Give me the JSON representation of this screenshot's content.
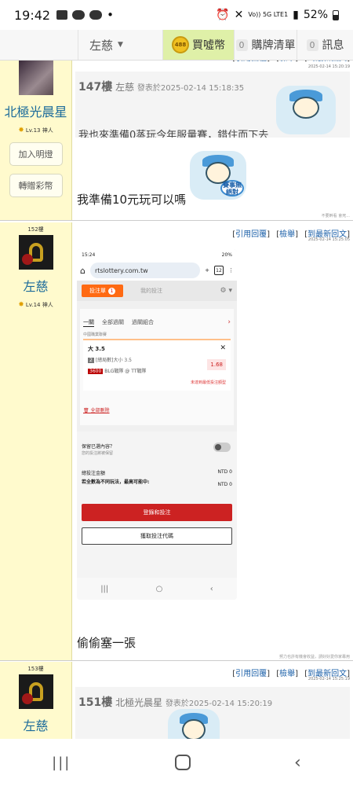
{
  "status": {
    "time": "19:42",
    "network": "Vo)) 5G LTE1",
    "battery": "52%"
  },
  "topnav": {
    "user": "左慈",
    "coins_icon_text": "488",
    "coins": "買噓幣",
    "cart_count": "0",
    "cart": "購牌清單",
    "msg_count": "0",
    "msg": "訊息"
  },
  "actions": {
    "quote": "引用回覆",
    "report": "檢舉",
    "latest": "到最新回文"
  },
  "post_prev": {
    "username": "北極光晨星",
    "level": "Lv.13 神人",
    "btn_light": "加入明燈",
    "btn_gift": "轉贈彩幣",
    "timestamp": "2025-02-14 15:20:19",
    "quote_floor": "147樓",
    "quote_user": "左慈",
    "quote_time": "發表於2025-02-14 15:18:35",
    "quote_text": "我也來準備0蒸玩今年服量賽，錯住而下去",
    "body": "我準備10元玩可以嗎",
    "sticker_sign": "賽事無絕對",
    "footnote": "不要幹看 會死..."
  },
  "post_main": {
    "floor": "152樓",
    "username": "左慈",
    "level": "Lv.14 神人",
    "timestamp": "2025-02-14 15:25:05",
    "body": "偷偷塞一張",
    "footnote": "努力也許有機會收益，請好好愛你家專用"
  },
  "screenshot": {
    "status_time": "15:24",
    "status_right": "20%",
    "url": "rtslottery.com.tw",
    "tabs_count": "12",
    "tab_active": "投注單",
    "tab_active_num": "1",
    "tab_inactive": "我的投注",
    "ptab1": "一關",
    "ptab2": "全部過關",
    "ptab3": "過關組合",
    "league": "中國職業聯賽",
    "bet_title": "大 3.5",
    "bet_detail_num": "2",
    "bet_detail": "[總局數]大小 3.5",
    "bet_code": "3600",
    "bet_match": "BLG戰隊 @ TT戰隊",
    "odds": "1.68",
    "warn": "未達到最低投注額型",
    "delete_all": "全部刪除",
    "keep_q": "保留已選內容？",
    "keep_hint": "您的投注將被保留",
    "total_label": "總投注金額",
    "total_value": "NTD 0",
    "max_label": "若全數為不同玩法，最高可能中:",
    "max_value": "NTD 0",
    "btn_login": "登錄和投注",
    "btn_code": "獲取投注代碼"
  },
  "post_next": {
    "floor": "153樓",
    "username": "左慈",
    "timestamp": "2025-02-14 15:25:19",
    "quote_floor": "151樓",
    "quote_user": "北極光晨星",
    "quote_time": "發表於2025-02-14 15:20:19"
  }
}
